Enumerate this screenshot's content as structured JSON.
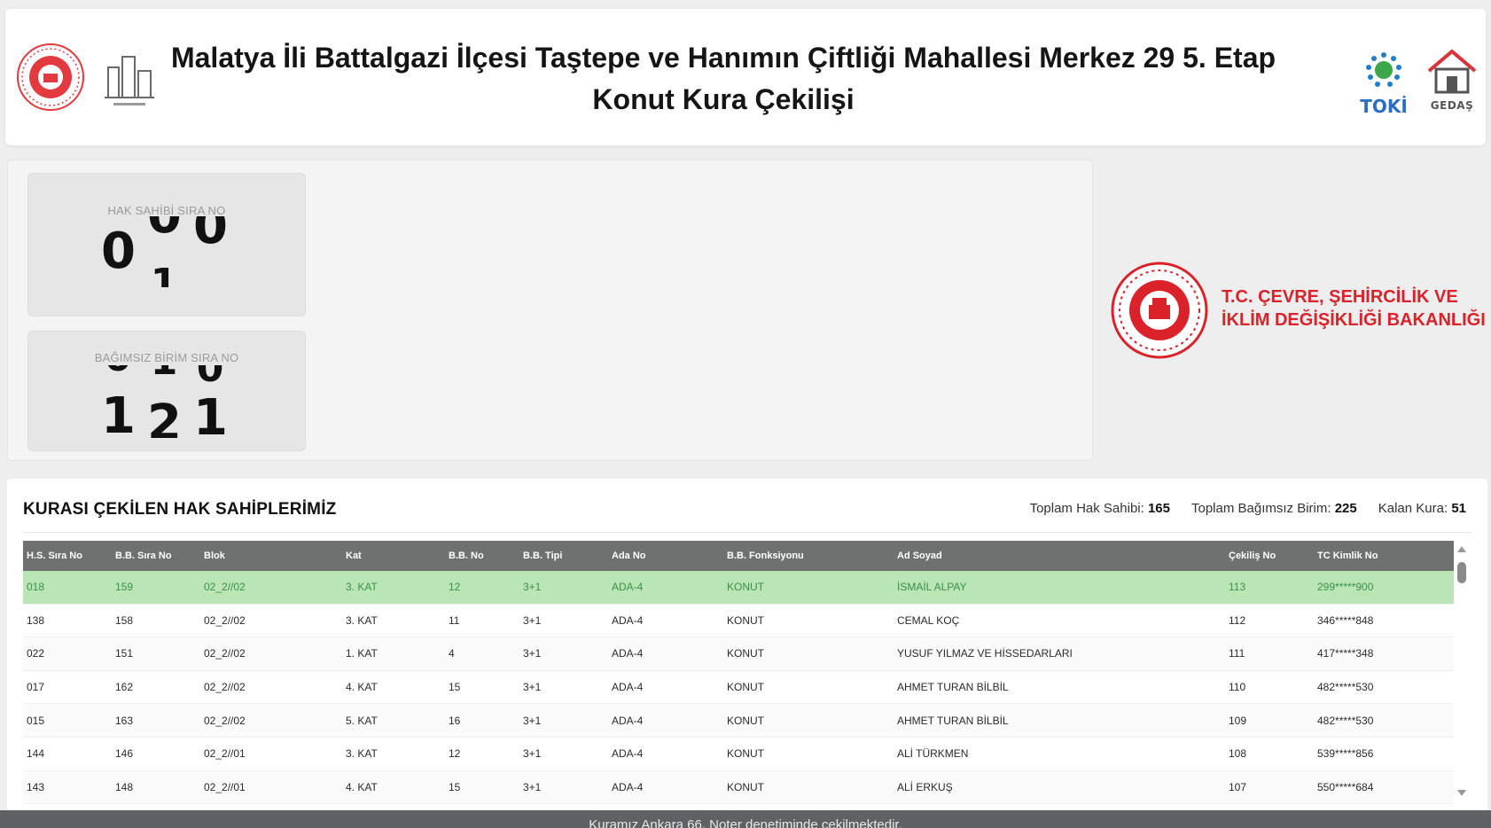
{
  "header": {
    "title_line1": "Malatya İli Battalgazi İlçesi Taştepe ve Hanımın Çiftliği Mahallesi Merkez 29 5. Etap",
    "title_line2": "Konut Kura Çekilişi",
    "logos": {
      "left_emblem": "red-seal-emblem-icon",
      "city": "city-buildings-icon",
      "toki_text": "TOKİ",
      "gedas_text": "GEDAŞ"
    }
  },
  "draw": {
    "hak_sahibi_label": "HAK SAHİBİ SIRA NO",
    "hak_sahibi_digits": [
      "0",
      "0",
      "0"
    ],
    "bagimsiz_birim_label": "BAĞIMSIZ BİRİM SIRA NO",
    "bagimsiz_birim_digits": [
      "1",
      "2",
      "1"
    ]
  },
  "ministry": {
    "line1": "T.C. ÇEVRE, ŞEHİRCİLİK VE",
    "line2": "İKLİM DEĞİŞİKLİĞİ BAKANLIĞI"
  },
  "results": {
    "title": "KURASI ÇEKİLEN HAK SAHİPLERİMİZ",
    "stats": {
      "total_owner_label": "Toplam Hak Sahibi:",
      "total_owner_value": "165",
      "total_unit_label": "Toplam Bağımsız Birim:",
      "total_unit_value": "225",
      "remaining_label": "Kalan Kura:",
      "remaining_value": "51"
    },
    "columns": [
      "H.S. Sıra No",
      "B.B. Sıra No",
      "Blok",
      "Kat",
      "B.B. No",
      "B.B. Tipi",
      "Ada No",
      "B.B. Fonksiyonu",
      "Ad Soyad",
      "Çekiliş No",
      "TC Kimlik No"
    ],
    "rows": [
      [
        "018",
        "159",
        "02_2//02",
        "3. KAT",
        "12",
        "3+1",
        "ADA-4",
        "KONUT",
        "İSMAİL ALPAY",
        "113",
        "299*****900"
      ],
      [
        "138",
        "158",
        "02_2//02",
        "3. KAT",
        "11",
        "3+1",
        "ADA-4",
        "KONUT",
        "CEMAL KOÇ",
        "112",
        "346*****848"
      ],
      [
        "022",
        "151",
        "02_2//02",
        "1. KAT",
        "4",
        "3+1",
        "ADA-4",
        "KONUT",
        "YUSUF YILMAZ VE HİSSEDARLARI",
        "111",
        "417*****348"
      ],
      [
        "017",
        "162",
        "02_2//02",
        "4. KAT",
        "15",
        "3+1",
        "ADA-4",
        "KONUT",
        "AHMET TURAN BİLBİL",
        "110",
        "482*****530"
      ],
      [
        "015",
        "163",
        "02_2//02",
        "5. KAT",
        "16",
        "3+1",
        "ADA-4",
        "KONUT",
        "AHMET TURAN BİLBİL",
        "109",
        "482*****530"
      ],
      [
        "144",
        "146",
        "02_2//01",
        "3. KAT",
        "12",
        "3+1",
        "ADA-4",
        "KONUT",
        "ALİ TÜRKMEN",
        "108",
        "539*****856"
      ],
      [
        "143",
        "148",
        "02_2//01",
        "4. KAT",
        "15",
        "3+1",
        "ADA-4",
        "KONUT",
        "ALİ ERKUŞ",
        "107",
        "550*****684"
      ]
    ]
  },
  "footer": {
    "text": "Kuramız Ankara 66. Noter denetiminde çekilmektedir."
  },
  "colors": {
    "highlight_row": "#b9e6b4",
    "table_header": "#6f7171",
    "ministry_red": "#d9222a",
    "toki_blue": "#2b6fc4"
  }
}
